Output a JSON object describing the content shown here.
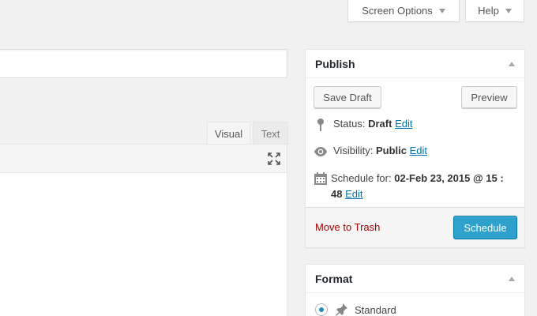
{
  "screen_meta": {
    "screen_options_label": "Screen Options",
    "help_label": "Help"
  },
  "editor": {
    "title_value": "",
    "tab_visual": "Visual",
    "tab_text": "Text"
  },
  "publish": {
    "title": "Publish",
    "save_draft": "Save Draft",
    "preview": "Preview",
    "status_label": "Status:",
    "status_value": "Draft",
    "visibility_label": "Visibility:",
    "visibility_value": "Public",
    "schedule_label": "Schedule for:",
    "schedule_value": "02-Feb 23, 2015 @ 15 : 48",
    "edit_label": "Edit",
    "move_to_trash": "Move to Trash",
    "schedule_button": "Schedule"
  },
  "format": {
    "title": "Format",
    "selected_option": "Standard"
  },
  "colors": {
    "primary_button": "#2ea2cc",
    "trash_link": "#a00000",
    "link": "#0073aa"
  }
}
